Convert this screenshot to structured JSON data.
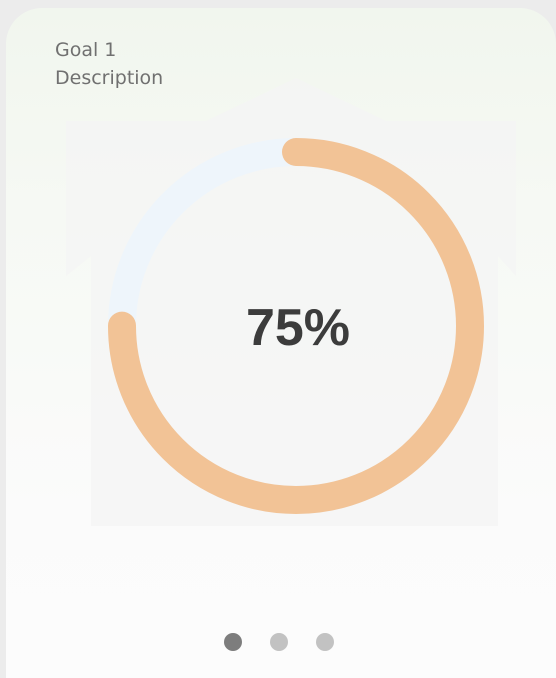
{
  "goal": {
    "title": "Goal 1",
    "description": "Description"
  },
  "progress": {
    "percent": 75,
    "label": "75%",
    "track_color": "#eef5fb",
    "fill_color": "#f2c396"
  },
  "pager": {
    "count": 3,
    "active_index": 0,
    "active_color": "#7d7d7d",
    "inactive_color": "#c2c2c2"
  }
}
